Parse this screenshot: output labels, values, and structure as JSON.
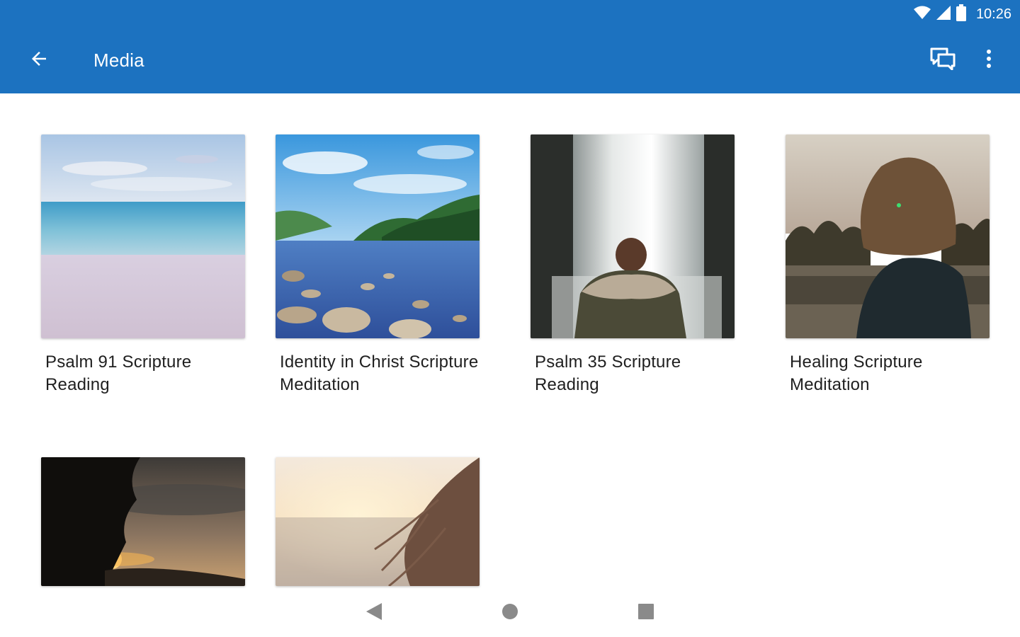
{
  "status_bar": {
    "time": "10:26",
    "icons": [
      "wifi-icon",
      "cellular-signal-icon",
      "battery-icon"
    ]
  },
  "toolbar": {
    "back_icon": "arrow-back-icon",
    "title": "Media",
    "actions": [
      "chat-bubbles-icon",
      "more-vert-icon"
    ]
  },
  "media_items": [
    {
      "title": "Psalm 91 Scripture Reading",
      "image": "beach-ocean"
    },
    {
      "title": "Identity in Christ Scripture Meditation",
      "image": "lake-rocks-forest"
    },
    {
      "title": "Psalm 35 Scripture Reading",
      "image": "waterfall-person"
    },
    {
      "title": "Healing Scripture Meditation",
      "image": "woman-lake-sunset"
    },
    {
      "title": "",
      "image": "tree-sunset"
    },
    {
      "title": "",
      "image": "hair-sunlight"
    }
  ],
  "nav_bar": {
    "icons": [
      "nav-back-icon",
      "nav-home-icon",
      "nav-recents-icon"
    ]
  },
  "colors": {
    "primary": "#1c72c0",
    "text": "#1f1f1f",
    "nav_icon": "#8a8a8a"
  }
}
